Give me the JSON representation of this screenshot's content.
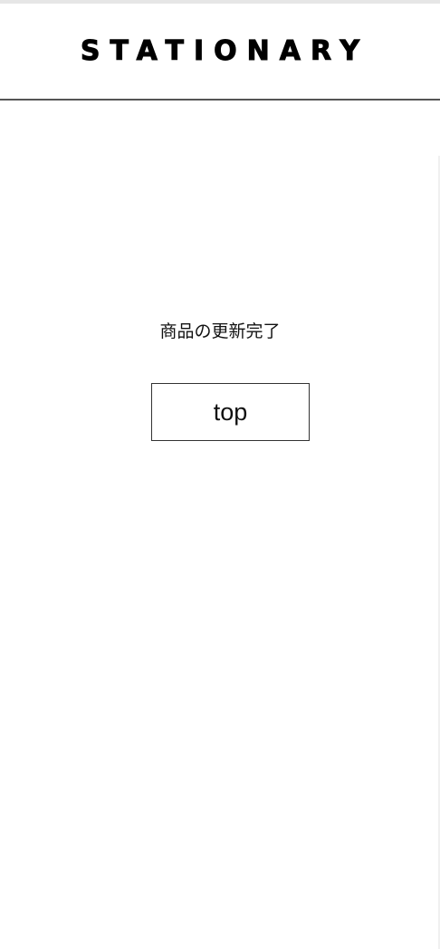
{
  "header": {
    "logo_text": "STATIONARY"
  },
  "main": {
    "message": "商品の更新完了",
    "top_button_label": "top"
  },
  "colors": {
    "background": "#ffffff",
    "text": "#111111",
    "header_border": "#555555"
  }
}
